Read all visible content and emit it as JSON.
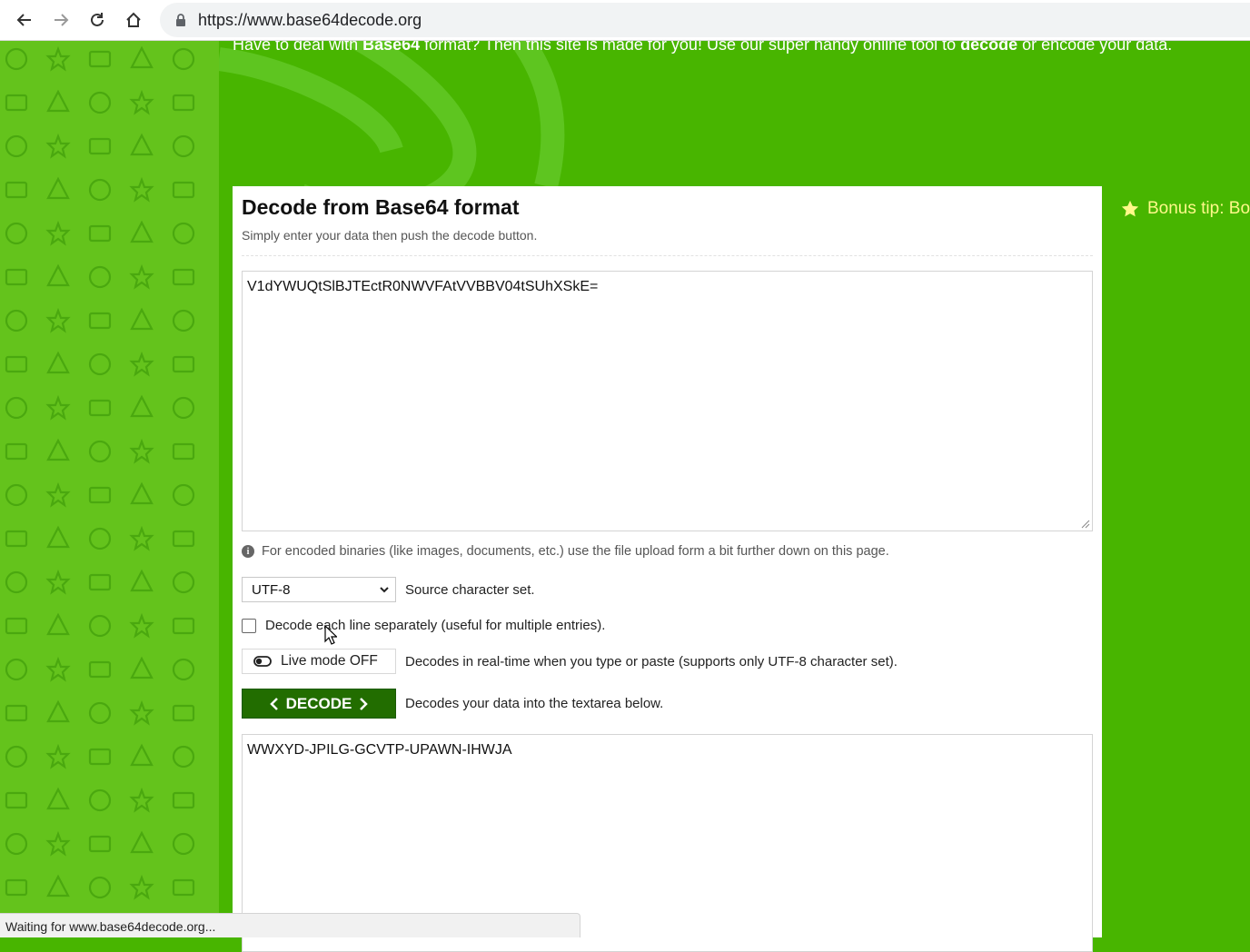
{
  "browser": {
    "url": "https://www.base64decode.org",
    "icons": [
      "back-arrow-icon",
      "forward-arrow-icon",
      "reload-icon",
      "home-icon",
      "lock-icon"
    ]
  },
  "header": {
    "intro_part1": "Have to deal with ",
    "intro_bold1": "Base64",
    "intro_part2": " format? Then this site is made for you! Use our super handy online tool to ",
    "intro_bold2": "decode",
    "intro_part3": " or encode your data."
  },
  "sidebar_right": {
    "bonus_tip": "Bonus tip: Boo",
    "icon": "star-icon"
  },
  "decoder": {
    "title": "Decode from Base64 format",
    "subtitle": "Simply enter your data then push the decode button.",
    "input_value": "V1dYWUQtSlBJTEctR0NWVFAtVVBBV04tSUhXSkE=",
    "info_text": "For encoded binaries (like images, documents, etc.) use the file upload form a bit further down on this page.",
    "charset": {
      "selected": "UTF-8",
      "label": "Source character set."
    },
    "each_line": {
      "checked": false,
      "label": "Decode each line separately (useful for multiple entries)."
    },
    "live_mode": {
      "label": "Live mode OFF",
      "description": "Decodes in real-time when you type or paste (supports only UTF-8 character set)."
    },
    "decode_button": {
      "label": "DECODE",
      "description": "Decodes your data into the textarea below."
    },
    "output_value": "WWXYD-JPILG-GCVTP-UPAWN-IHWJA"
  },
  "status": {
    "text": "Waiting for www.base64decode.org..."
  },
  "colors": {
    "brand_green": "#48b500",
    "pattern_green": "#64c31c",
    "button_green": "#226d00",
    "bonus_yellow": "#fff98a"
  }
}
